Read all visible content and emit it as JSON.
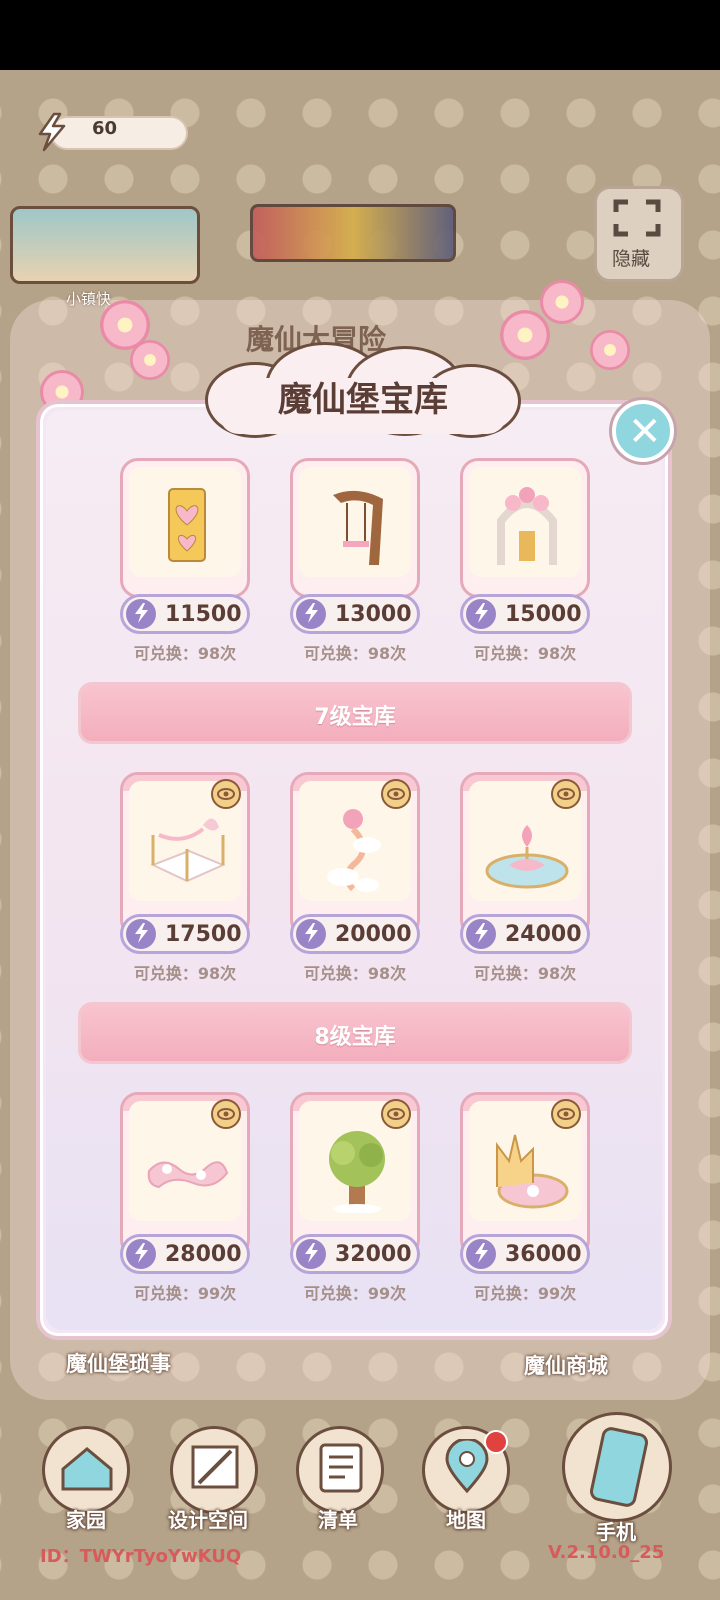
{
  "energy": {
    "value": "60"
  },
  "background": {
    "thumb_label": "小镇快",
    "hide_label": "隐藏",
    "panel_title": "魔仙大冒险"
  },
  "dialog": {
    "title": "魔仙堡宝库",
    "close": "✕"
  },
  "rows": [
    {
      "items": [
        {
          "price": "11500",
          "count": "可兑换：98次"
        },
        {
          "price": "13000",
          "count": "可兑换：98次"
        },
        {
          "price": "15000",
          "count": "可兑换：98次"
        }
      ]
    },
    {
      "section": "7级宝库",
      "items": [
        {
          "price": "17500",
          "count": "可兑换：98次"
        },
        {
          "price": "20000",
          "count": "可兑换：98次"
        },
        {
          "price": "24000",
          "count": "可兑换：98次"
        }
      ]
    },
    {
      "section": "8级宝库",
      "items": [
        {
          "price": "28000",
          "count": "可兑换：99次"
        },
        {
          "price": "32000",
          "count": "可兑换：99次"
        },
        {
          "price": "36000",
          "count": "可兑换：99次"
        }
      ]
    }
  ],
  "bottom": {
    "left_link": "魔仙堡琐事",
    "right_link": "魔仙商城"
  },
  "nav": [
    {
      "label": "家园",
      "icon": "house-icon"
    },
    {
      "label": "设计空间",
      "icon": "design-icon"
    },
    {
      "label": "清单",
      "icon": "list-icon"
    },
    {
      "label": "地图",
      "icon": "map-pin-icon"
    },
    {
      "label": "手机",
      "icon": "phone-icon"
    }
  ],
  "footer": {
    "id": "ID：TWYrTyoYwKUQ",
    "version": "V.2.10.0_25"
  },
  "colors": {
    "accent_pink": "#f3aebd",
    "price_purple": "#9a84c8",
    "close_cyan": "#8fd6df"
  }
}
